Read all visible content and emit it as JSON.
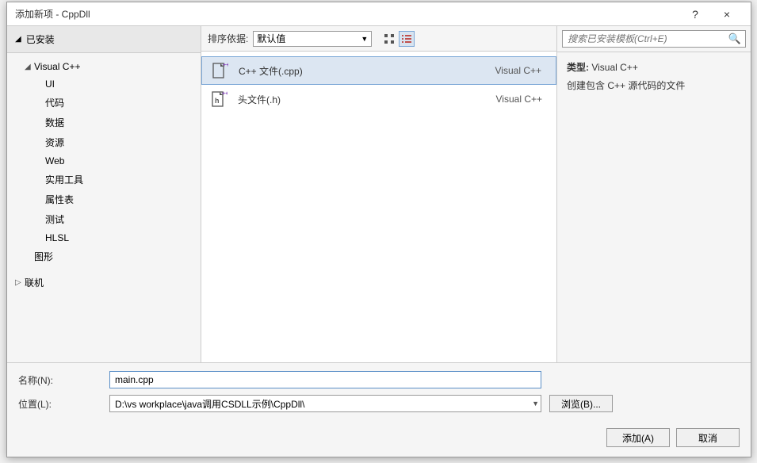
{
  "title": "添加新项 - CppDll",
  "titlebar": {
    "help": "?",
    "close": "×"
  },
  "sidebar": {
    "installed": "已安装",
    "vcpp": "Visual C++",
    "items": [
      "UI",
      "代码",
      "数据",
      "资源",
      "Web",
      "实用工具",
      "属性表",
      "测试",
      "HLSL"
    ],
    "graphics": "图形",
    "online": "联机"
  },
  "toolbar": {
    "sort_label": "排序依据:",
    "sort_value": "默认值"
  },
  "templates": [
    {
      "name": "C++ 文件(.cpp)",
      "lang": "Visual C++"
    },
    {
      "name": "头文件(.h)",
      "lang": "Visual C++"
    }
  ],
  "search": {
    "placeholder": "搜索已安装模板(Ctrl+E)"
  },
  "info": {
    "type_label": "类型:",
    "type_value": "Visual C++",
    "desc": "创建包含 C++ 源代码的文件"
  },
  "form": {
    "name_label": "名称(N):",
    "name_value": "main.cpp",
    "location_label": "位置(L):",
    "location_value": "D:\\vs workplace\\java调用CSDLL示例\\CppDll\\",
    "browse": "浏览(B)..."
  },
  "footer": {
    "add": "添加(A)",
    "cancel": "取消"
  }
}
